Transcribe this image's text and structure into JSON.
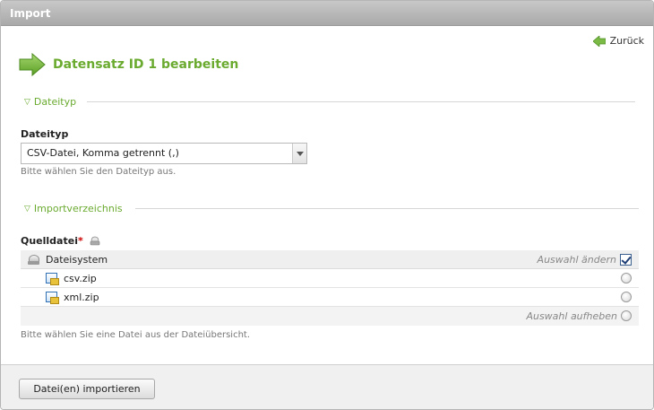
{
  "window": {
    "title": "Import"
  },
  "back_link": {
    "label": "Zurück"
  },
  "heading": {
    "title": "Datensatz ID 1 bearbeiten"
  },
  "sections": {
    "dateityp": {
      "legend": "Dateityp",
      "field_label": "Dateityp",
      "select_value": "CSV-Datei, Komma getrennt (,)",
      "hint": "Bitte wählen Sie den Dateityp aus."
    },
    "importverzeichnis": {
      "legend": "Importverzeichnis",
      "field_label": "Quelldatei",
      "required_marker": "*",
      "hint": "Bitte wählen Sie eine Datei aus der Dateiübersicht."
    }
  },
  "file_tree": {
    "root": {
      "label": "Dateisystem",
      "action": "Auswahl ändern",
      "checked": true
    },
    "files": [
      {
        "name": "csv.zip",
        "selected": false
      },
      {
        "name": "xml.zip",
        "selected": false
      }
    ],
    "clear_action": "Auswahl aufheben"
  },
  "footer": {
    "import_button": "Datei(en) importieren"
  },
  "colors": {
    "accent": "#6aaa2f",
    "required": "#cc0000"
  },
  "icons": [
    "back-arrow-icon",
    "heading-arrow-icon",
    "collapse-triangle-icon",
    "help-icon",
    "drive-icon",
    "zip-file-icon"
  ]
}
